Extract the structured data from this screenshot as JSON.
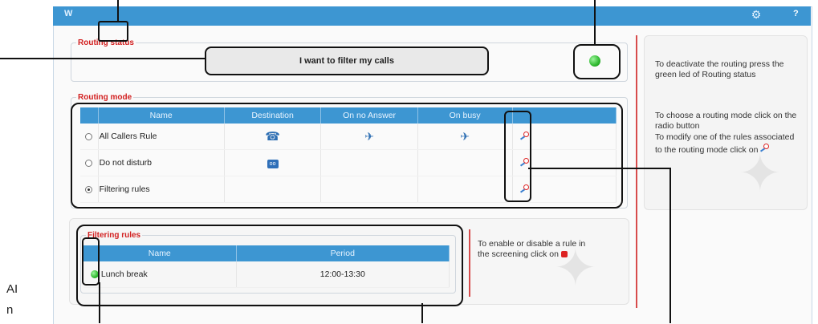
{
  "window": {
    "logo": "W",
    "help_label": "?"
  },
  "routing_status": {
    "legend": "Routing status",
    "banner": "I want to filter my calls",
    "led_color": "#2eb82e"
  },
  "routing_mode": {
    "legend": "Routing mode",
    "columns": [
      "Name",
      "Destination",
      "On no Answer",
      "On busy"
    ],
    "rows": [
      {
        "name": "All Callers Rule",
        "selected": false,
        "destination": "voicemail-icon",
        "no_answer": "forward-icon",
        "busy": "forward-icon"
      },
      {
        "name": "Do not disturb",
        "selected": false,
        "destination": "voicebox-icon",
        "no_answer": "",
        "busy": ""
      },
      {
        "name": "Filtering rules",
        "selected": true,
        "destination": "",
        "no_answer": "",
        "busy": ""
      }
    ]
  },
  "filtering_rules": {
    "legend": "Filtering rules",
    "columns": [
      "Name",
      "Period"
    ],
    "rows": [
      {
        "name": "Lunch break",
        "period": "12:00-13:30",
        "enabled": true
      }
    ],
    "help": "To enable or disable a rule in the screening click on"
  },
  "help_panel": {
    "deactivate": "To deactivate the routing press the green led of Routing status",
    "choose_mode": "To choose a routing mode click on the radio button",
    "modify_rules": "To modify one of the rules associated to the routing mode click on"
  },
  "margin_text": {
    "line1": "AI",
    "line2": "n"
  },
  "colors": {
    "accent": "#3d96d2",
    "legend_red": "#d21f1f",
    "divider_red": "#d74b4b"
  }
}
